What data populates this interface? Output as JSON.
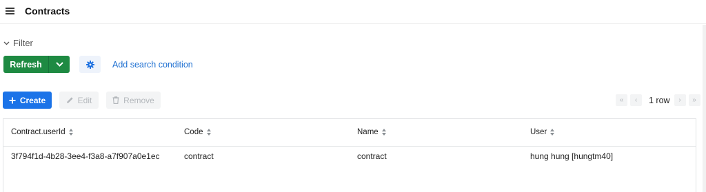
{
  "header": {
    "title": "Contracts"
  },
  "filter": {
    "label": "Filter",
    "add_condition": "Add search condition"
  },
  "toolbar": {
    "refresh_label": "Refresh",
    "create_label": "Create",
    "edit_label": "Edit",
    "remove_label": "Remove"
  },
  "pager": {
    "count_label": "1 row"
  },
  "table": {
    "columns": [
      "Contract.userId",
      "Code",
      "Name",
      "User"
    ],
    "rows": [
      [
        "3f794f1d-4b28-3ee4-f3a8-a7f907a0e1ec",
        "contract",
        "contract",
        "hung hung [hungtm40]"
      ]
    ]
  },
  "colors": {
    "refresh_button": "#1e8a42",
    "create_button": "#1b73e8",
    "link": "#1d6fd1",
    "disabled_button": "#f3f4f5"
  },
  "icons": [
    "menu-icon",
    "chevron-down-icon",
    "gear-icon",
    "plus-icon",
    "pencil-icon",
    "trash-icon",
    "first-page-icon",
    "prev-page-icon",
    "next-page-icon",
    "last-page-icon",
    "sort-icon"
  ]
}
